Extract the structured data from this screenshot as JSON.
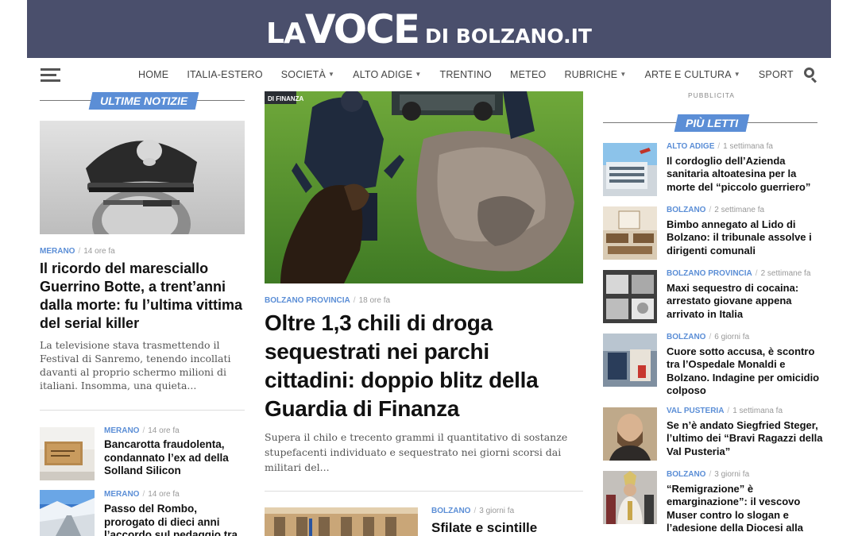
{
  "site": {
    "logo_la": "LA",
    "logo_voce": "VOCE",
    "logo_rest": "DI BOLZANO.IT"
  },
  "nav": {
    "items": [
      {
        "label": "HOME",
        "dropdown": false
      },
      {
        "label": "ITALIA-ESTERO",
        "dropdown": false
      },
      {
        "label": "SOCIETÀ",
        "dropdown": true
      },
      {
        "label": "ALTO ADIGE",
        "dropdown": true
      },
      {
        "label": "TRENTINO",
        "dropdown": false
      },
      {
        "label": "METEO",
        "dropdown": false
      },
      {
        "label": "RUBRICHE",
        "dropdown": true
      },
      {
        "label": "ARTE E CULTURA",
        "dropdown": true
      },
      {
        "label": "SPORT",
        "dropdown": false
      }
    ]
  },
  "ad_label": "PUBBLICITA",
  "left": {
    "section_title": "ULTIME NOTIZIE",
    "lead": {
      "category": "MERANO",
      "time": "14 ore fa",
      "title": "Il ricordo del maresciallo Guerrino Botte, a trent’anni dalla morte: fu l’ultima vittima del serial killer",
      "excerpt": "La televisione stava trasmettendo il Festival di Sanremo, tenendo incollati davanti al proprio schermo milioni di italiani. Insomma, una quieta..."
    },
    "items": [
      {
        "category": "MERANO",
        "time": "14 ore fa",
        "title": "Bancarotta fraudolenta, condannato l’ex ad della Solland Silicon"
      },
      {
        "category": "MERANO",
        "time": "14 ore fa",
        "title": "Passo del Rombo, prorogato di dieci anni l’accordo sul pedaggio tra Alto Adige e"
      }
    ]
  },
  "main": {
    "category": "BOLZANO PROVINCIA",
    "time": "18 ore fa",
    "title": "Oltre 1,3 chili di droga sequestrati nei parchi cittadini: doppio blitz della Guardia di Finanza",
    "excerpt": "Supera il chilo e trecento grammi il quantitativo di sostanze stupefacenti individuato e sequestrato nei giorni scorsi dai militari del...",
    "image_caption": "DI FINANZA",
    "next": {
      "category": "BOLZANO",
      "time": "3 giorni fa",
      "title": "Sfilate e scintille"
    }
  },
  "right": {
    "section_title": "PIÙ LETTI",
    "items": [
      {
        "category": "ALTO ADIGE",
        "time": "1 settimana fa",
        "title": "Il cordoglio dell’Azienda sanitaria altoatesina per la morte del “piccolo guerriero”"
      },
      {
        "category": "BOLZANO",
        "time": "2 settimane fa",
        "title": "Bimbo annegato al Lido di Bolzano: il tribunale assolve i dirigenti comunali"
      },
      {
        "category": "BOLZANO PROVINCIA",
        "time": "2 settimane fa",
        "title": "Maxi sequestro di cocaina: arrestato giovane appena arrivato in Italia"
      },
      {
        "category": "BOLZANO",
        "time": "6 giorni fa",
        "title": "Cuore sotto accusa, è scontro tra l’Ospedale Monaldi e Bolzano. Indagine per omicidio colposo"
      },
      {
        "category": "VAL PUSTERIA",
        "time": "1 settimana fa",
        "title": "Se n’è andato Siegfried Steger, l’ultimo dei “Bravi Ragazzi della Val Pusteria”"
      },
      {
        "category": "BOLZANO",
        "time": "3 giorni fa",
        "title": "“Remigrazione” è emarginazione”: il vescovo Muser contro lo slogan e l’adesione della Diocesi alla"
      }
    ]
  },
  "colors": {
    "header_bg": "#4a4f6c",
    "accent": "#5b8ed6"
  }
}
